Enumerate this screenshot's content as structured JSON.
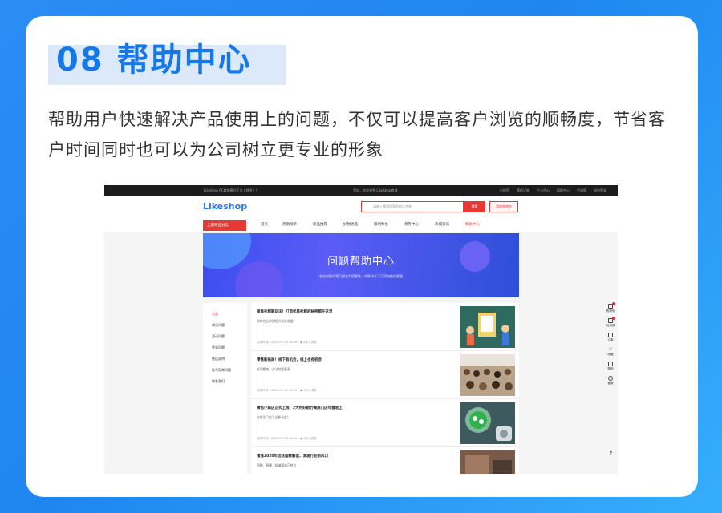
{
  "heading": {
    "number": "08",
    "title": "帮助中心"
  },
  "description": "帮助用户快速解决产品使用上的问题，不仅可以提高客户浏览的顺畅度，节省客户时间同时也可以为公司树立更专业的形象",
  "topbar": {
    "notice": "LikeShop PC商城模式正式上线啦！！",
    "greeting": "您好，欢迎来到 LikeShop商城",
    "links": [
      "小程序",
      "我的订单",
      "个人中心",
      "帮助中心",
      "手机版",
      "退出登录"
    ]
  },
  "header": {
    "logo": "Likeshop",
    "search_placeholder": "请输入需要搜索的商品名称",
    "search_button": "搜索",
    "cart_button": "我的购物车"
  },
  "nav": {
    "category_button": "全部商品分类",
    "items": [
      "首页",
      "热销榜单",
      "新品推荐",
      "好物优选",
      "限时秒杀",
      "领券中心",
      "商城资讯",
      "帮助中心"
    ]
  },
  "banner": {
    "title": "问题帮助中心",
    "subtitle": "有任何疑问我们都会为您解答，如解决不了可添加微信客服"
  },
  "sidebar": {
    "items": [
      "全部",
      "常见问题",
      "活动问题",
      "登录问题",
      "售后说明",
      "账号异常问题",
      "联系我们"
    ]
  },
  "articles": [
    {
      "title": "聚焦社群新玩法！打造优质社群的秘密都在这里",
      "summary": "如何在社群里吸引粉丝流量？",
      "date": "发布时间：2020-07-30 16:39",
      "views": "0次人浏览"
    },
    {
      "title": "零售新格局！线下有机会，线上也有机会",
      "summary": "新问题来，方法你是更多",
      "date": "发布时间：2020-07-30 16:39",
      "views": "0次人浏览"
    },
    {
      "title": "微信小商店正式上线，2大利好助力微商门店年营收上",
      "summary": "化茶品门店又迎新机会！",
      "date": "发布时间：2020-07-30 16:39",
      "views": "0次人浏览"
    },
    {
      "title": "看涨2020年活跃指数解读，发现行业新风口",
      "summary": "团购、直播、私域渠道正热点",
      "date": "",
      "views": ""
    }
  ],
  "floatbar": {
    "items": [
      "购物车",
      "优惠券",
      "订单",
      "收藏",
      "帮助",
      "客服"
    ]
  },
  "colors": {
    "accent": "#1677e6",
    "shop_red": "#e53935",
    "banner": "#3b4ef0"
  }
}
